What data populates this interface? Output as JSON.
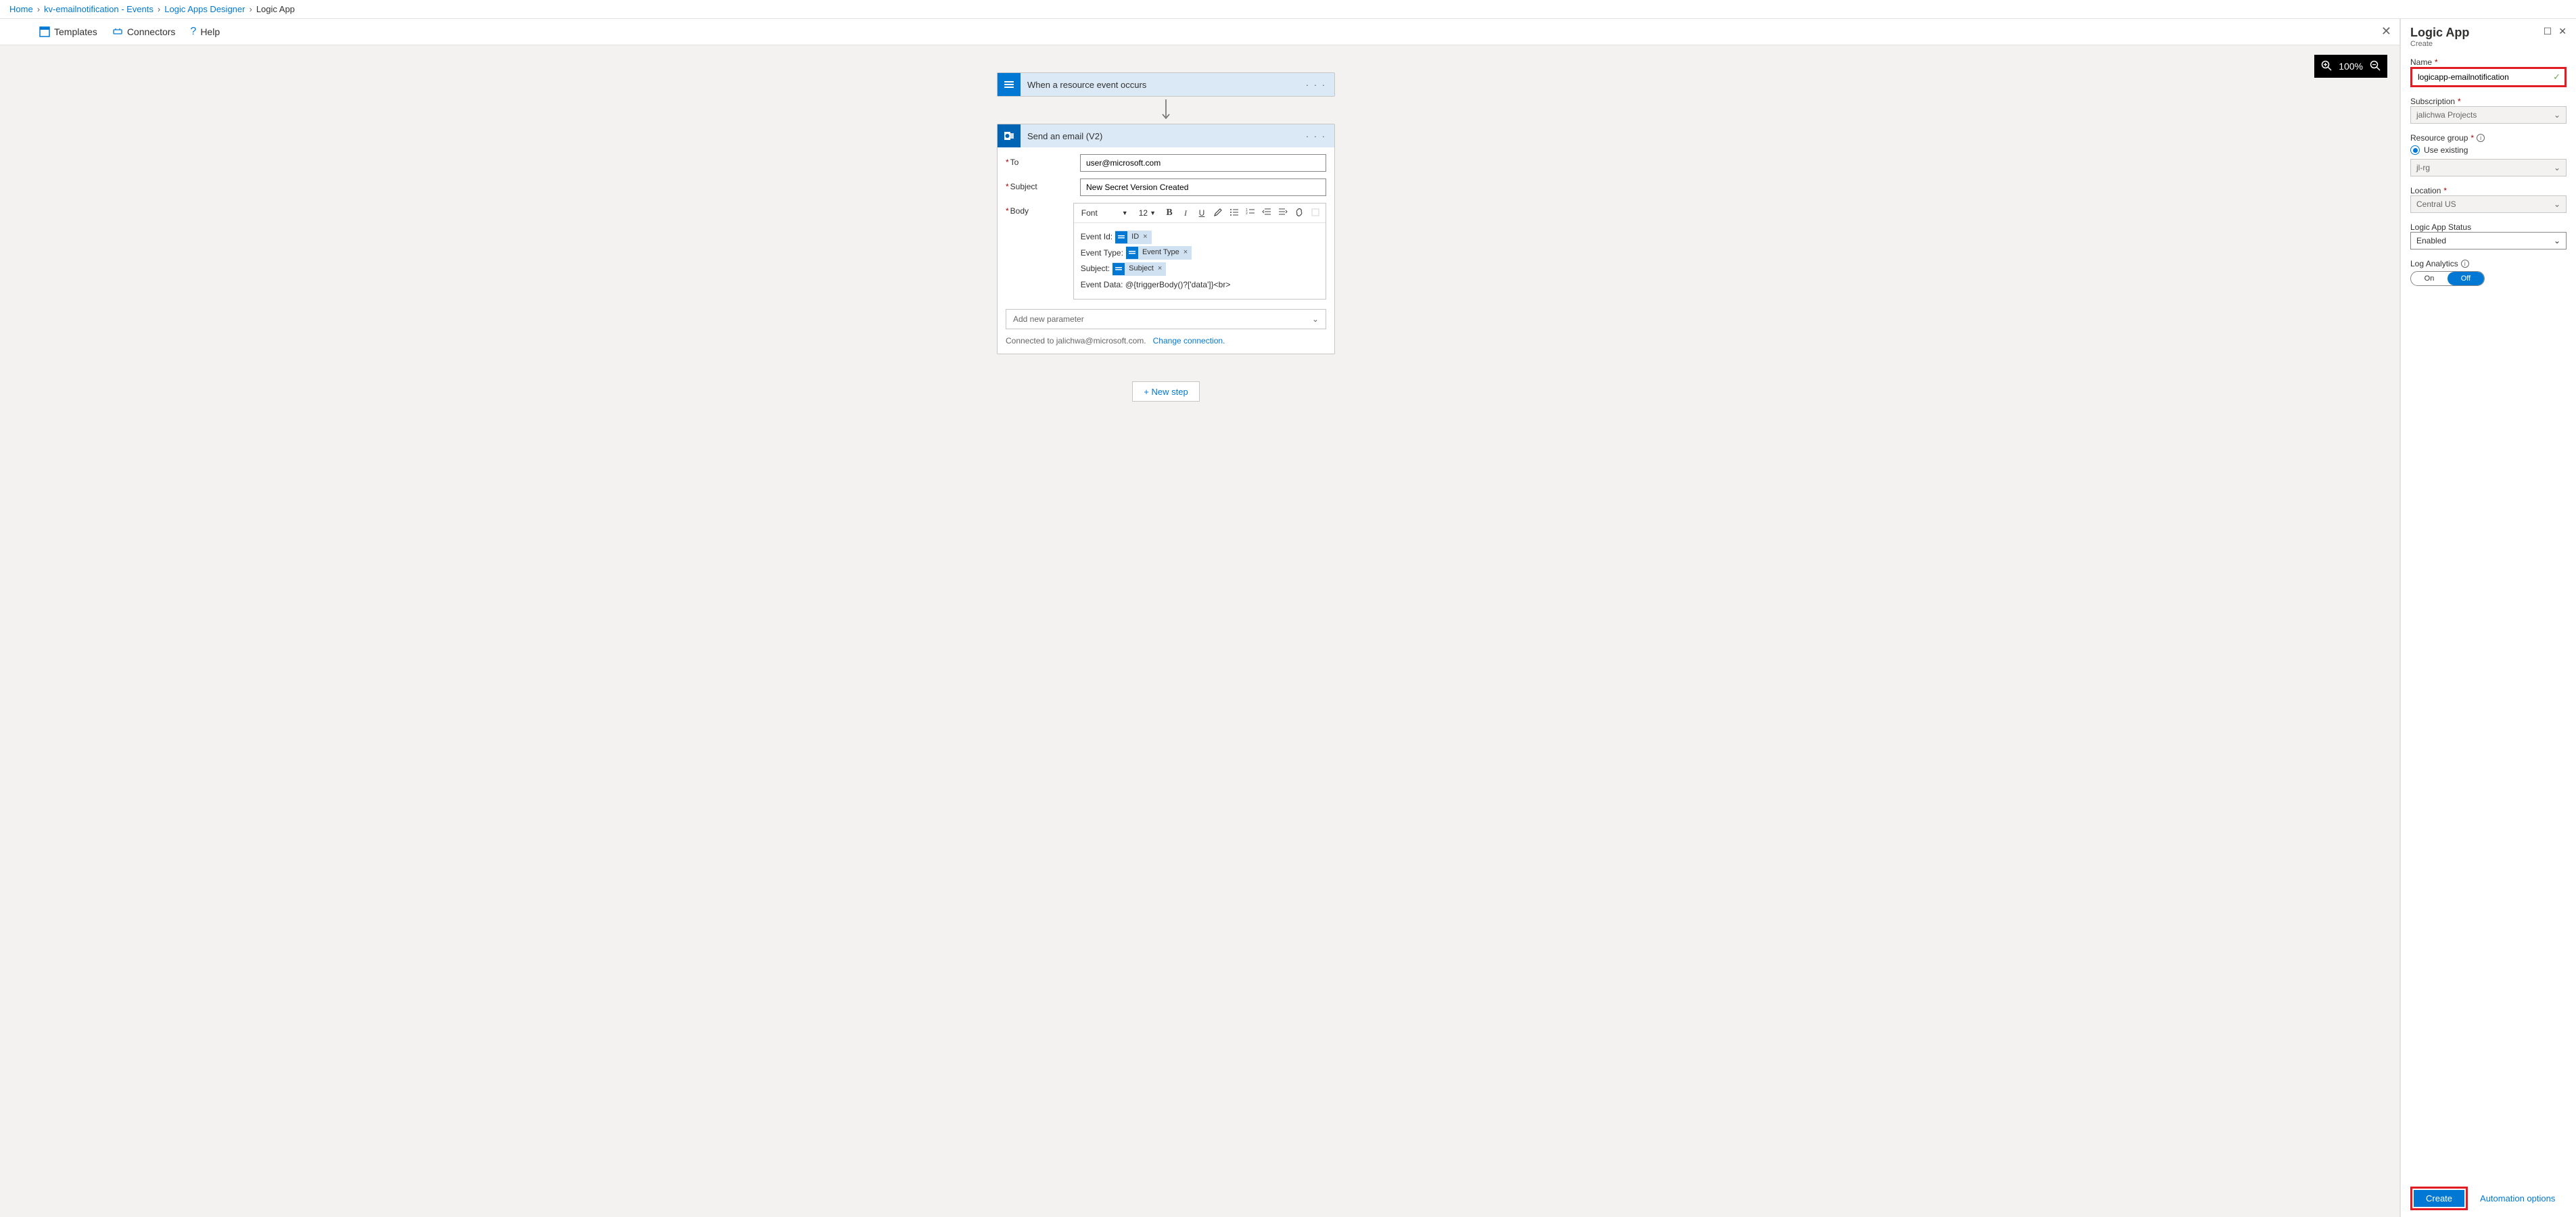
{
  "breadcrumb": {
    "items": [
      "Home",
      "kv-emailnotification - Events",
      "Logic Apps Designer"
    ],
    "current": "Logic App"
  },
  "toolbar": {
    "templates": "Templates",
    "connectors": "Connectors",
    "help": "Help"
  },
  "zoom": {
    "level": "100%"
  },
  "flow": {
    "trigger": {
      "title": "When a resource event occurs"
    },
    "action": {
      "title": "Send an email (V2)",
      "to_label": "To",
      "to_value": "user@microsoft.com",
      "subject_label": "Subject",
      "subject_value": "New Secret Version Created",
      "body_label": "Body",
      "rte": {
        "font": "Font",
        "size": "12"
      },
      "body_lines": {
        "l1_label": "Event Id:",
        "l1_token": "ID",
        "l2_label": "Event Type:",
        "l2_token": "Event Type",
        "l3_label": "Subject:",
        "l3_token": "Subject",
        "l4_text": "Event Data: @{triggerBody()?['data']}<br>"
      },
      "add_param": "Add new parameter",
      "conn_text": "Connected to jalichwa@microsoft.com.",
      "conn_change": "Change connection."
    },
    "new_step": "+ New step"
  },
  "pane": {
    "title": "Logic App",
    "subtitle": "Create",
    "name_label": "Name",
    "name_value": "logicapp-emailnotification",
    "sub_label": "Subscription",
    "sub_value": "jalichwa Projects",
    "rg_label": "Resource group",
    "rg_radio": "Use existing",
    "rg_value": "jl-rg",
    "loc_label": "Location",
    "loc_value": "Central US",
    "status_label": "Logic App Status",
    "status_value": "Enabled",
    "log_label": "Log Analytics",
    "log_on": "On",
    "log_off": "Off",
    "create": "Create",
    "auto": "Automation options"
  }
}
